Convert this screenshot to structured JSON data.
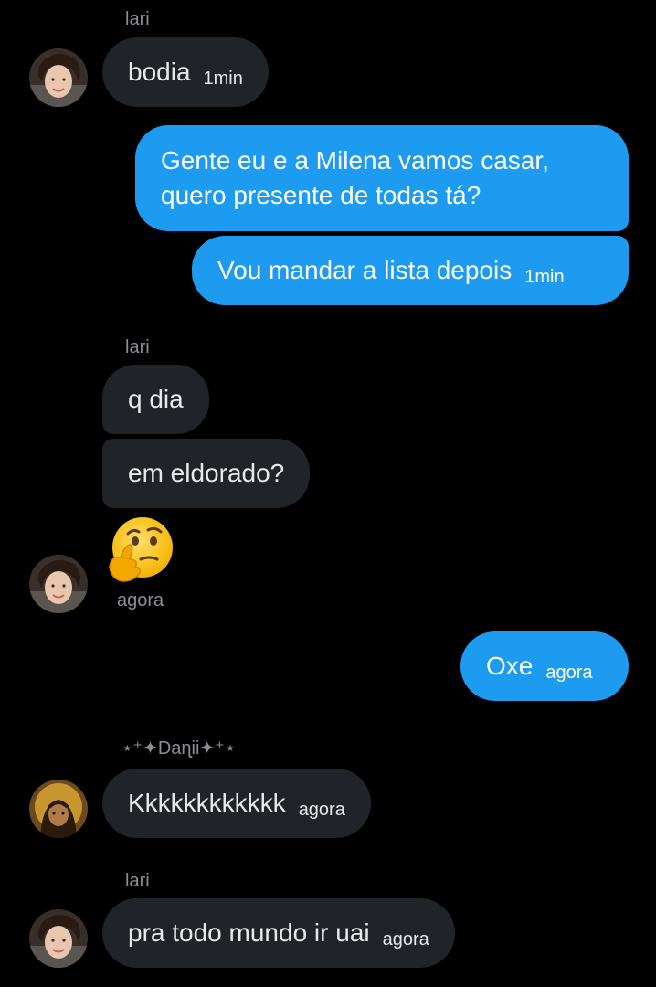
{
  "messages": [
    {
      "sender": "lari",
      "text": "bodia",
      "time": "1min"
    },
    {
      "text": "Gente eu e a Milena vamos casar,",
      "text2": "quero presente de todas tá?"
    },
    {
      "text": "Vou mandar a lista depois",
      "time": "1min"
    },
    {
      "sender": "lari",
      "text": "q dia"
    },
    {
      "text": "em eldorado?"
    },
    {
      "emoji": "thinking-face",
      "time": "agora"
    },
    {
      "text": "Oxe",
      "time": "agora"
    },
    {
      "sender": "⋆⁺✦Daɳii✦⁺⋆",
      "text": "Kkkkkkkkkkkk",
      "time": "agora"
    },
    {
      "sender": "lari",
      "text": "pra todo mundo ir uai",
      "time": "agora"
    }
  ],
  "colors": {
    "background": "#000000",
    "incoming_bubble": "#202327",
    "outgoing_bubble": "#1d9bf0",
    "secondary_text": "#8b8f94"
  }
}
